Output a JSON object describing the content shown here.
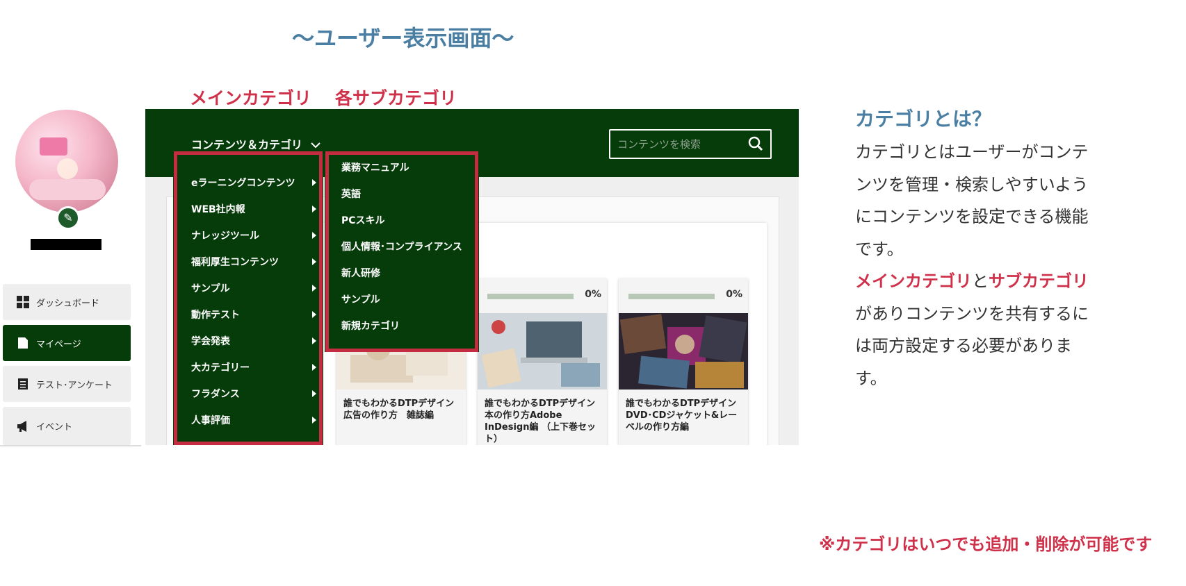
{
  "page_title": "〜ユーザー表示画面〜",
  "labels": {
    "main_category": "メインカテゴリ",
    "sub_category": "各サブカテゴリ"
  },
  "sidebar": {
    "items": [
      {
        "label": "ダッシュボード",
        "icon": "dashboard-icon"
      },
      {
        "label": "マイページ",
        "icon": "page-icon",
        "active": true
      },
      {
        "label": "テスト･アンケート",
        "icon": "clipboard-icon"
      },
      {
        "label": "イベント",
        "icon": "megaphone-icon"
      }
    ]
  },
  "app": {
    "menu_label": "コンテンツ＆カテゴリ",
    "search_placeholder": "コンテンツを検索",
    "main_categories": [
      "eラーニングコンテンツ",
      "WEB社内報",
      "ナレッジツール",
      "福利厚生コンテンツ",
      "サンプル",
      "動作テスト",
      "学会発表",
      "大カテゴリー",
      "フラダンス",
      "人事評価"
    ],
    "sub_categories": [
      "業務マニュアル",
      "英語",
      "PCスキル",
      "個人情報･コンプライアンス",
      "新人研修",
      "サンプル",
      "新規カテゴリ"
    ],
    "courses": [
      {
        "progress": "",
        "title": "誰でもわかるDTPデザイン　広告の作り方　雑誌編"
      },
      {
        "progress": "0%",
        "title": "誰でもわかるDTPデザイン　本の作り方Adobe InDesign編 （上下巻セット）"
      },
      {
        "progress": "0%",
        "title": "誰でもわかるDTPデザイン　DVD･CDジャケット&レーベルの作り方編"
      }
    ]
  },
  "explanation": {
    "heading": "カテゴリとは？",
    "para1": "カテゴリとはユーザーがコンテンツを管理・検索しやすいようにコンテンツを設定できる機能です。",
    "em1": "メインカテゴリ",
    "mid": "と",
    "em2": "サブカテゴリ",
    "para2": "がありコンテンツを共有するには両方設定する必要があります。"
  },
  "note": "※カテゴリはいつでも追加・削除が可能です",
  "colors": {
    "dark_green": "#063c0a",
    "accent_red": "#d0314a",
    "heading_blue": "#4a7fa3"
  }
}
